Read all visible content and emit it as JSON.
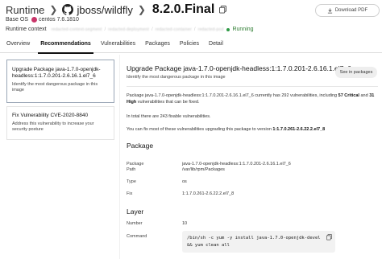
{
  "header": {
    "root": "Runtime",
    "repo": "jboss/wildfly",
    "tag": "8.2.0.Final",
    "download_label": "Download PDF",
    "base_os_label": "Base OS",
    "base_os_value": "centos 7.6.1810",
    "runtime_context_label": "Runtime context",
    "context_segments": [
      "redacted-context-segment",
      "redacted-deployment",
      "redacted-container",
      "redacted-pod"
    ],
    "status": "Running"
  },
  "tabs": [
    "Overview",
    "Recommendations",
    "Vulnerabilities",
    "Packages",
    "Policies",
    "Detail"
  ],
  "active_tab": "Recommendations",
  "recommendations": [
    {
      "title": "Upgrade Package java-1.7.0-openjdk-headless:1:1.7.0.201-2.6.16.1.el7_6",
      "description": "Identify the most dangerous package in this image"
    },
    {
      "title": "Fix Vulnerability CVE-2020-8840",
      "description": "Address this vulnerability to increase your security posture"
    }
  ],
  "detail": {
    "title": "Upgrade Package java-1.7.0-openjdk-headless:1:1.7.0.201-2.6.16.1.el7_6",
    "subtitle": "Identify the most dangerous package in this image",
    "see_in_packages": "See in packages",
    "para1_pre": "Package java-1.7.0-openjdk-headless:1:1.7.0.201-2.6.16.1.el7_6 currently has 292 vulnerabilities, including ",
    "para1_critical": "57 Critical",
    "para1_mid": " and ",
    "para1_high": "31 High",
    "para1_post": " vulnerabilities that can be fixed.",
    "para2": "In total there are 243 fixable vulnerabilities.",
    "para3_pre": "You can fix most of these vulnerabilities upgrading this package to version ",
    "para3_version": "1:1.7.0.261-2.6.22.2.el7_8",
    "package_section": "Package",
    "package_fields": [
      {
        "key": "Package",
        "value": "java-1.7.0-openjdk-headless:1:1.7.0.201-2.6.16.1.el7_6"
      },
      {
        "key": "Path",
        "value": "/var/lib/rpm/Packages"
      },
      {
        "key": "Type",
        "value": "os"
      },
      {
        "key": "Fix",
        "value": "1:1.7.0.261-2.6.22.2.el7_8"
      }
    ],
    "layer_section": "Layer",
    "layer_fields": [
      {
        "key": "Number",
        "value": "10"
      },
      {
        "key": "Command",
        "value": ""
      }
    ],
    "command": "/bin/sh -c yum -y install java-1.7.0-openjdk-devel && yum clean all"
  }
}
